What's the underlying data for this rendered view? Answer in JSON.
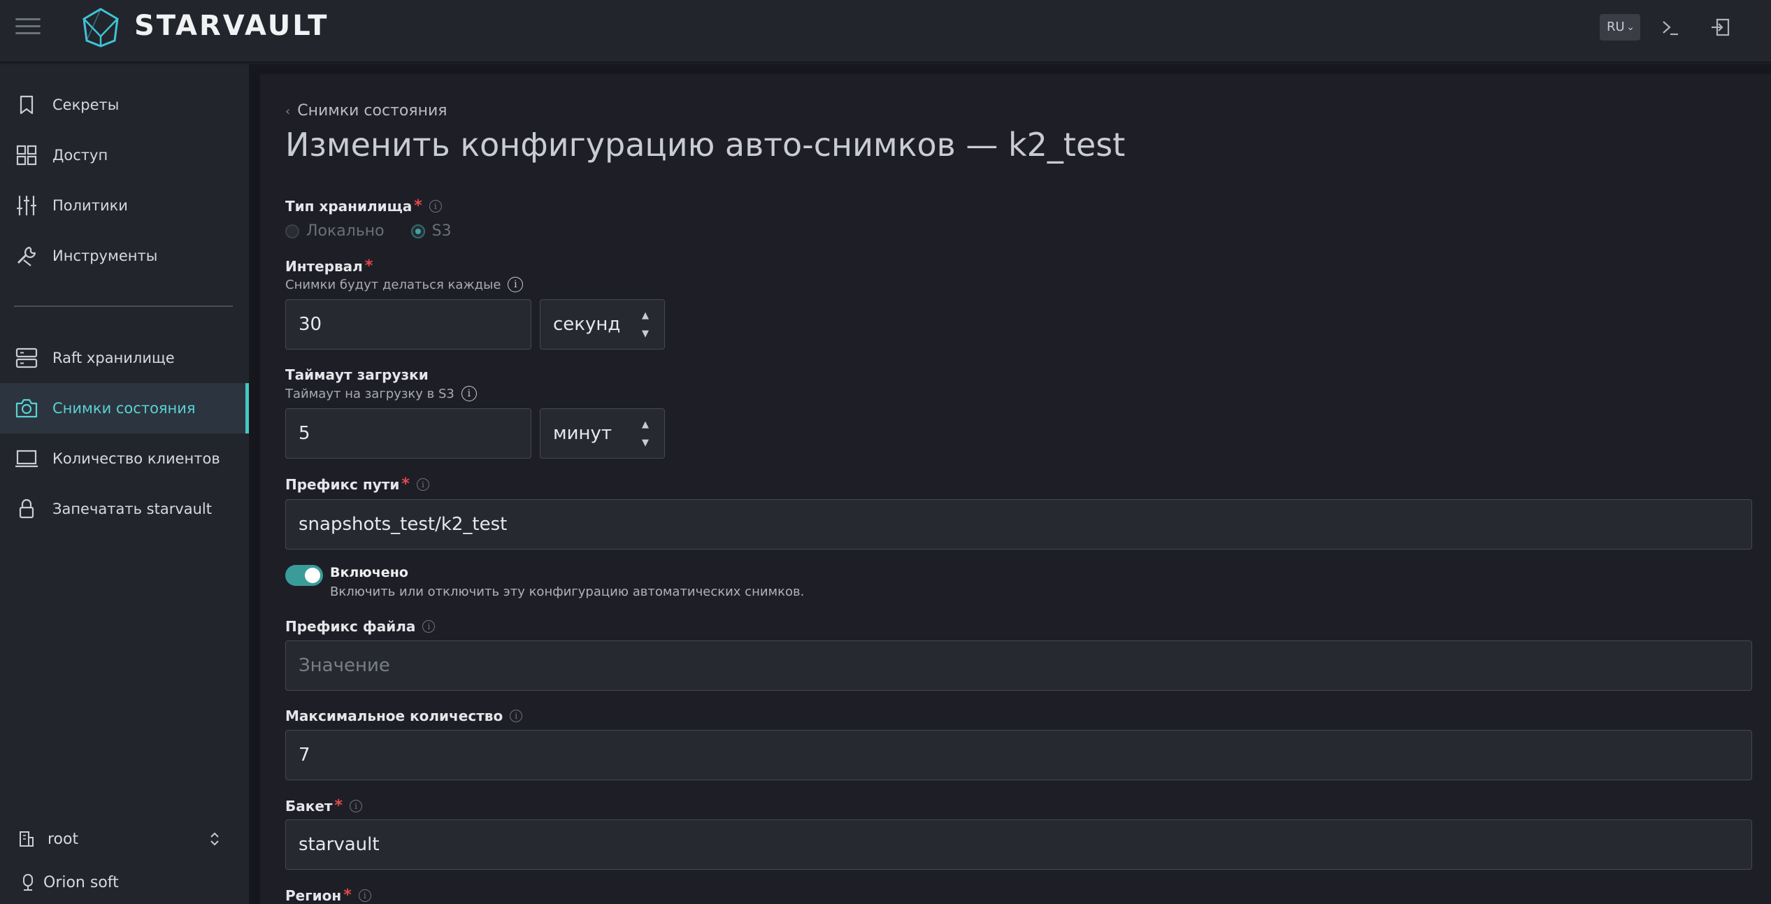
{
  "header": {
    "brand": "STARVAULT",
    "lang": "RU",
    "icons": [
      "menu-icon",
      "terminal-icon",
      "logout-icon"
    ]
  },
  "sidebar": {
    "items": [
      {
        "label": "Секреты",
        "icon": "bookmark-icon"
      },
      {
        "label": "Доступ",
        "icon": "grid-icon"
      },
      {
        "label": "Политики",
        "icon": "sliders-icon"
      },
      {
        "label": "Инструменты",
        "icon": "wrench-icon"
      },
      {
        "label": "Raft хранилище",
        "icon": "server-icon"
      },
      {
        "label": "Снимки состояния",
        "icon": "camera-icon",
        "active": true
      },
      {
        "label": "Количество клиентов",
        "icon": "monitor-icon"
      },
      {
        "label": "Запечатать starvault",
        "icon": "lock-icon"
      }
    ],
    "namespace": "root",
    "org": "Orion soft"
  },
  "main": {
    "breadcrumb": "Снимки состояния",
    "title": "Изменить конфигурацию авто-снимков — k2_test",
    "storage_type": {
      "label": "Тип хранилища",
      "options": [
        "Локально",
        "S3"
      ],
      "selected": "S3"
    },
    "interval": {
      "label": "Интервал",
      "help": "Снимки будут делаться каждые",
      "value": "30",
      "unit": "секунд"
    },
    "upload_timeout": {
      "label": "Таймаут загрузки",
      "help": "Таймаут на загрузку в S3",
      "value": "5",
      "unit": "минут"
    },
    "path_prefix": {
      "label": "Префикс пути",
      "value": "snapshots_test/k2_test"
    },
    "enabled": {
      "label": "Включено",
      "description": "Включить или отключить эту конфигурацию автоматических снимков.",
      "on": true
    },
    "file_prefix": {
      "label": "Префикс файла",
      "placeholder": "Значение"
    },
    "max_count": {
      "label": "Максимальное количество",
      "value": "7"
    },
    "bucket": {
      "label": "Бакет",
      "value": "starvault"
    },
    "region": {
      "label": "Регион"
    }
  },
  "colors": {
    "accent": "#46c6c4",
    "required": "#e5484d",
    "background": "#1e1f26",
    "sidebar": "#23252c"
  }
}
